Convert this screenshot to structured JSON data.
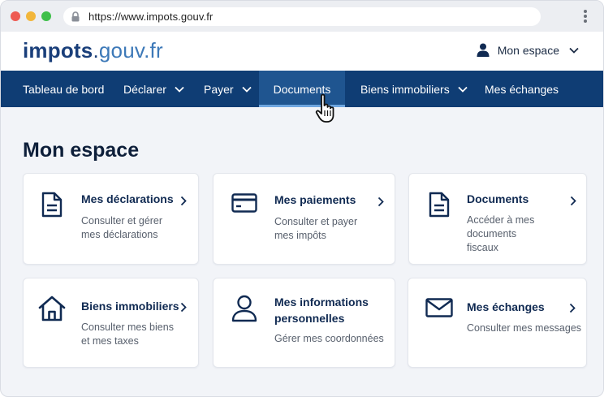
{
  "browser": {
    "url": "https://www.impots.gouv.fr"
  },
  "header": {
    "logo_part1": "impots",
    "logo_dot": ".",
    "logo_part2": "gouv.fr",
    "account_label": "Mon espace"
  },
  "nav": {
    "items": [
      {
        "label": "Tableau de bord"
      },
      {
        "label": "Déclarer"
      },
      {
        "label": "Payer"
      },
      {
        "label": "Documents"
      },
      {
        "label": "Biens immobiliers"
      },
      {
        "label": "Mes échanges"
      }
    ],
    "active": "Documents"
  },
  "main": {
    "title": "Mon espace",
    "cards": [
      {
        "title": "Mes déclarations",
        "desc_line1": "Consulter et gérer",
        "desc_line2": "mes déclarations",
        "icon": "document-icon"
      },
      {
        "title": "Mes paiements",
        "desc_line1": "Consulter et payer",
        "desc_line2": "mes impôts",
        "icon": "credit-card-icon"
      },
      {
        "title": "Documents",
        "desc_line1": "Accéder à mes documents",
        "desc_line2": "fiscaux",
        "icon": "document-icon"
      },
      {
        "title": "Biens immobiliers",
        "desc_line1": "Consulter mes biens",
        "desc_line2": "et mes taxes",
        "icon": "house-icon"
      },
      {
        "title_line1": "Mes informations",
        "title_line2": "personnelles",
        "desc_line1": "Gérer mes coordonnées",
        "icon": "person-icon"
      },
      {
        "title": "Mes échanges",
        "desc_line1": "Consulter mes messages",
        "icon": "envelope-icon"
      }
    ]
  },
  "colors": {
    "nav_bg": "#0f3d74",
    "nav_active_bg": "#1f5590",
    "brand_dark": "#1a3f7a",
    "brand_light": "#3d79b8",
    "page_bg": "#f2f4f8"
  }
}
